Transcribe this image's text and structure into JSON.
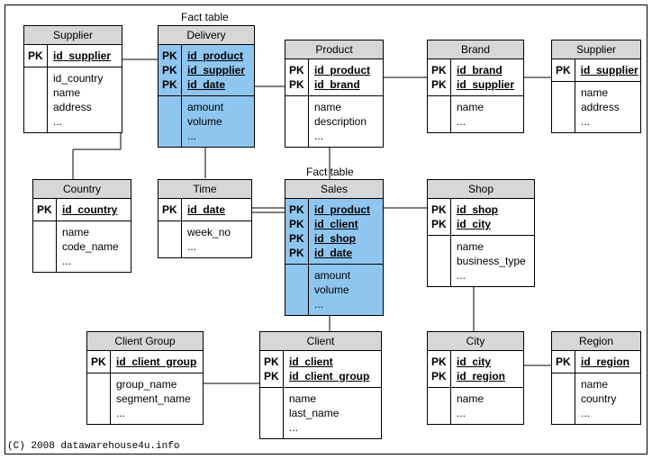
{
  "labels": {
    "fact_top": "Fact table",
    "fact_mid": "Fact table",
    "copyright": "(C) 2008 datawarehouse4u.info"
  },
  "tables": {
    "supplier_left": {
      "title": "Supplier",
      "pk": [
        "id_supplier"
      ],
      "attrs": [
        "id_country",
        "name",
        "address",
        "..."
      ]
    },
    "delivery": {
      "title": "Delivery",
      "pk": [
        "id_product",
        "id_supplier",
        "id_date"
      ],
      "attrs": [
        "amount",
        "volume",
        "..."
      ]
    },
    "product": {
      "title": "Product",
      "pk": [
        "id_product",
        "id_brand"
      ],
      "attrs": [
        "name",
        "description",
        "..."
      ]
    },
    "brand": {
      "title": "Brand",
      "pk": [
        "id_brand",
        "id_supplier"
      ],
      "attrs": [
        "name",
        "..."
      ]
    },
    "supplier_right": {
      "title": "Supplier",
      "pk": [
        "id_supplier"
      ],
      "attrs": [
        "name",
        "address",
        "..."
      ]
    },
    "country": {
      "title": "Country",
      "pk": [
        "id_country"
      ],
      "attrs": [
        "name",
        "code_name",
        "..."
      ]
    },
    "time": {
      "title": "Time",
      "pk": [
        "id_date"
      ],
      "attrs": [
        "week_no",
        "..."
      ]
    },
    "sales": {
      "title": "Sales",
      "pk": [
        "id_product",
        "id_client",
        "id_shop",
        "id_date"
      ],
      "attrs": [
        "amount",
        "volume",
        "..."
      ]
    },
    "shop": {
      "title": "Shop",
      "pk": [
        "id_shop",
        "id_city"
      ],
      "attrs": [
        "name",
        "business_type",
        "..."
      ]
    },
    "client_group": {
      "title": "Client Group",
      "pk": [
        "id_client_group"
      ],
      "attrs": [
        "group_name",
        "segment_name",
        "..."
      ]
    },
    "client": {
      "title": "Client",
      "pk": [
        "id_client",
        "id_client_group"
      ],
      "attrs": [
        "name",
        "last_name",
        "..."
      ]
    },
    "city": {
      "title": "City",
      "pk": [
        "id_city",
        "id_region"
      ],
      "attrs": [
        "name",
        "..."
      ]
    },
    "region": {
      "title": "Region",
      "pk": [
        "id_region"
      ],
      "attrs": [
        "name",
        "country",
        "..."
      ]
    }
  },
  "pk_label": "PK"
}
